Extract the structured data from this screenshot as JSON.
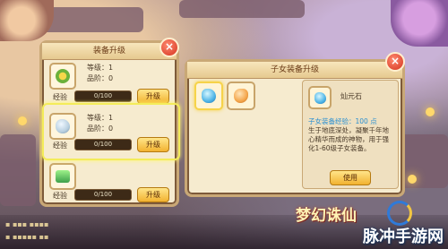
{
  "panel_left": {
    "title": "装备升级",
    "items": [
      {
        "icon": "key-item-icon",
        "level_label": "等级：1",
        "rank_label": "品阶：0",
        "exp_label": "经验",
        "exp_value": "0/100",
        "button": "升级"
      },
      {
        "icon": "crystal-item-icon",
        "level_label": "等级：1",
        "rank_label": "品阶：0",
        "exp_label": "经验",
        "exp_value": "0/100",
        "button": "升级"
      },
      {
        "icon": "green-box-item-icon",
        "level_label": "",
        "rank_label": "",
        "exp_label": "经验",
        "exp_value": "0/100",
        "button": "升级"
      }
    ]
  },
  "panel_right": {
    "title": "子女装备升级",
    "slots": [
      "blue-gem-icon",
      "orange-gem-icon"
    ],
    "detail": {
      "item_name": "灿元石",
      "exp_line": "子女装备经验：100 点",
      "description": "生于地底深处，凝聚千年地心精华而成的神物，用于强化1-60级子女装备。",
      "use_button": "使用"
    }
  },
  "background": {
    "logo": "梦幻诛仙",
    "watermark": "脉冲手游网"
  },
  "colors": {
    "accent_text": "#2a8fd1",
    "highlight": "#f4ec5a",
    "button_gradient_top": "#ffe58a",
    "close_button": "#d4321e"
  }
}
